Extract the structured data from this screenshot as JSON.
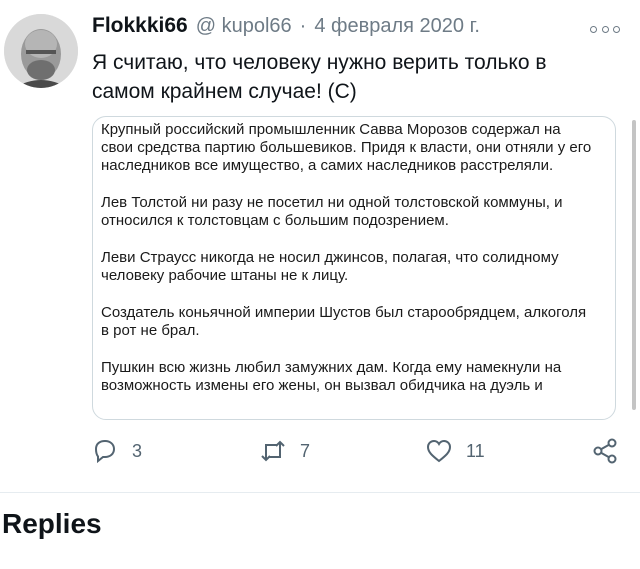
{
  "tweet": {
    "author_name": "Flokkki66",
    "handle": "@ kupol66",
    "separator": "·",
    "date": "4 февраля 2020 г.",
    "text": "Я считаю, что человеку нужно верить только в самом крайнем случае! (С)",
    "icons": {
      "more": "more-options-icon",
      "reply": "reply-icon",
      "retweet": "retweet-icon",
      "like": "heart-icon",
      "share": "share-icon"
    },
    "card_paragraphs": [
      "Крупный российский промышленник Савва Морозов содержал на свои средства партию большевиков. Придя к власти, они отняли у его наследников все имущество, а самих наследников расстреляли.",
      "Лев Толстой ни разу не посетил ни одной толстовской коммуны, и относился к толстовцам с большим подозрением.",
      "Леви Страусс никогда не носил джинсов, полагая, что солидному человеку рабочие штаны не к лицу.",
      "Создатель коньячной империи Шустов был старообрядцем, алкоголя в рот не брал.",
      "Пушкин всю жизнь любил замужних дам. Когда ему намекнули на возможность измены его жены, он вызвал обидчика на дуэль и"
    ],
    "stats": {
      "replies": "3",
      "retweets": "7",
      "likes": "11"
    }
  },
  "section": {
    "title": "Replies"
  },
  "colors": {
    "text": "#0f1419",
    "secondary": "#536471",
    "border": "#cfd9de"
  }
}
